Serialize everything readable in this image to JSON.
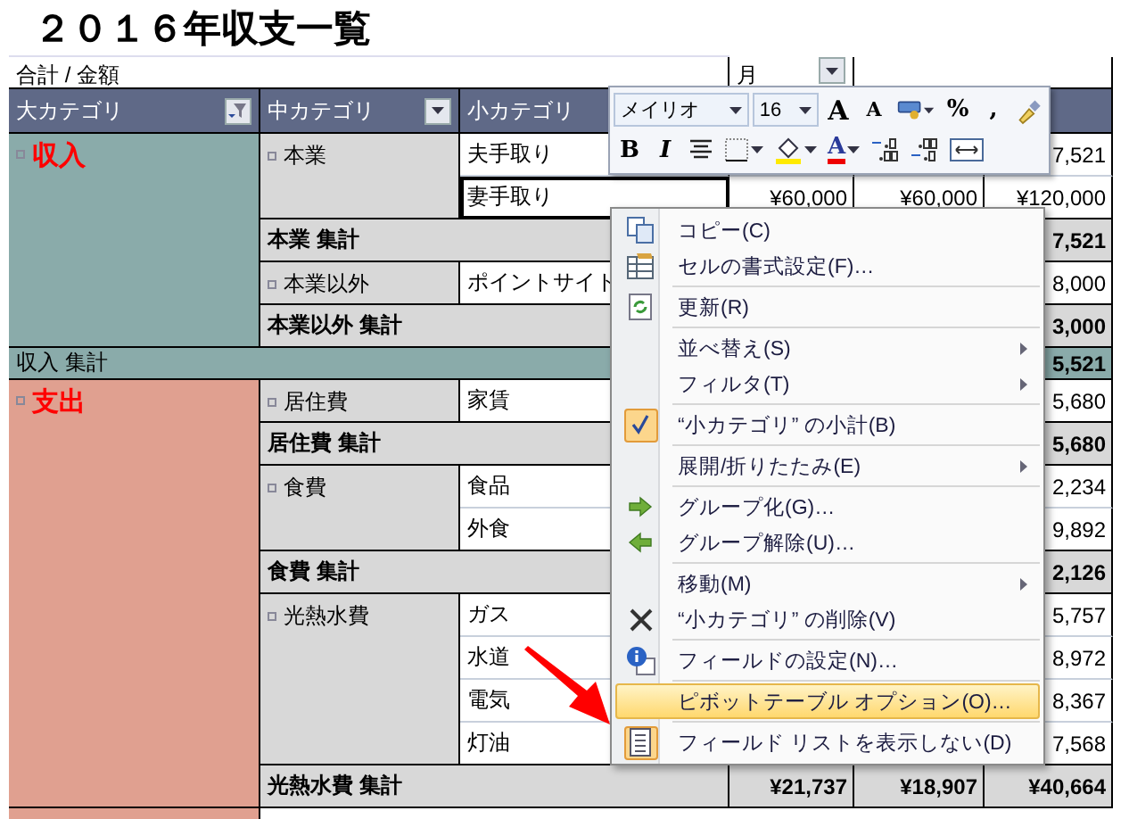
{
  "title": "２０１６年収支一覧",
  "pivot": {
    "data_label": "合計 / 金額",
    "column_field": "月",
    "headers": [
      {
        "label": "大カテゴリ",
        "filtered": true
      },
      {
        "label": "中カテゴリ",
        "filtered": false
      },
      {
        "label": "小カテゴリ"
      }
    ],
    "groups": [
      {
        "name": "収入",
        "color": "#8aabaa",
        "subgroups": [
          {
            "name": "本業",
            "items": [
              {
                "name": "夫手取り",
                "selected": false,
                "values": [
                  "7,521"
                ]
              },
              {
                "name": "妻手取り",
                "selected": true,
                "values": [
                  "¥60,000",
                  "¥60,000",
                  "¥120,000"
                ]
              }
            ],
            "total": {
              "label": "本業 集計",
              "values": [
                "7,521"
              ]
            }
          },
          {
            "name": "本業以外",
            "items": [
              {
                "name": "ポイントサイト",
                "selected": false,
                "values": [
                  "8,000"
                ]
              }
            ],
            "total": {
              "label": "本業以外 集計",
              "values": [
                "3,000"
              ]
            }
          }
        ],
        "total": {
          "label": "収入 集計",
          "values": [
            "5,521"
          ]
        }
      },
      {
        "name": "支出",
        "color": "#e0a090",
        "subgroups": [
          {
            "name": "居住費",
            "items": [
              {
                "name": "家賃",
                "selected": false,
                "values": [
                  "5,680"
                ]
              }
            ],
            "total": {
              "label": "居住費 集計",
              "values": [
                "5,680"
              ]
            }
          },
          {
            "name": "食費",
            "items": [
              {
                "name": "食品",
                "selected": false,
                "values": [
                  "2,234"
                ]
              },
              {
                "name": "外食",
                "selected": false,
                "values": [
                  "9,892"
                ]
              }
            ],
            "total": {
              "label": "食費 集計",
              "values": [
                "2,126"
              ]
            }
          },
          {
            "name": "光熱水費",
            "items": [
              {
                "name": "ガス",
                "selected": false,
                "values": [
                  "5,757"
                ]
              },
              {
                "name": "水道",
                "selected": false,
                "values": [
                  "8,972"
                ]
              },
              {
                "name": "電気",
                "selected": false,
                "values": [
                  "8,367"
                ]
              },
              {
                "name": "灯油",
                "selected": false,
                "values": [
                  "7,568"
                ]
              }
            ],
            "total": {
              "label": "光熱水費 集計",
              "values": [
                "¥21,737",
                "¥18,907",
                "¥40,664"
              ]
            }
          }
        ]
      }
    ]
  },
  "mini_toolbar": {
    "top_row": [
      {
        "kind": "font",
        "value": "メイリオ"
      },
      {
        "kind": "size",
        "value": "16"
      },
      {
        "kind": "grow",
        "label": "A"
      },
      {
        "kind": "shrink",
        "label": "A"
      },
      {
        "kind": "currency"
      },
      {
        "kind": "text",
        "label": "%"
      },
      {
        "kind": "text",
        "label": ","
      },
      {
        "kind": "painter"
      }
    ],
    "bottom_row": [
      {
        "kind": "bold",
        "label": "B"
      },
      {
        "kind": "italic",
        "label": "I"
      },
      {
        "kind": "center"
      },
      {
        "kind": "borders"
      },
      {
        "kind": "fill"
      },
      {
        "kind": "fontcolor",
        "label": "A"
      },
      {
        "kind": "incdec"
      },
      {
        "kind": "decdec"
      },
      {
        "kind": "merge"
      }
    ]
  },
  "context_menu": {
    "groups": [
      [
        {
          "label": "コピー(C)",
          "kind": "copy",
          "submenu": false,
          "checked": false,
          "selected": false
        },
        {
          "label": "セルの書式設定(F)…",
          "kind": "format",
          "submenu": false,
          "checked": false,
          "selected": false
        }
      ],
      [
        {
          "label": "更新(R)",
          "kind": "refresh",
          "submenu": false,
          "checked": false,
          "selected": false
        }
      ],
      [
        {
          "label": "並べ替え(S)",
          "kind": "plain",
          "submenu": true,
          "checked": false,
          "selected": false
        },
        {
          "label": "フィルタ(T)",
          "kind": "plain",
          "submenu": true,
          "checked": false,
          "selected": false
        }
      ],
      [
        {
          "label": "“小カテゴリ” の小計(B)",
          "kind": "check",
          "submenu": false,
          "checked": true,
          "selected": false
        }
      ],
      [
        {
          "label": "展開/折りたたみ(E)",
          "kind": "plain",
          "submenu": true,
          "checked": false,
          "selected": false
        }
      ],
      [
        {
          "label": "グループ化(G)…",
          "kind": "group",
          "submenu": false,
          "checked": false,
          "selected": false
        },
        {
          "label": "グループ解除(U)…",
          "kind": "ungroup",
          "submenu": false,
          "checked": false,
          "selected": false
        }
      ],
      [
        {
          "label": "移動(M)",
          "kind": "plain",
          "submenu": true,
          "checked": false,
          "selected": false
        },
        {
          "label": "“小カテゴリ” の削除(V)",
          "kind": "delete",
          "submenu": false,
          "checked": false,
          "selected": false
        }
      ],
      [
        {
          "label": "フィールドの設定(N)…",
          "kind": "info",
          "submenu": false,
          "checked": false,
          "selected": false
        }
      ],
      [
        {
          "label": "ピボットテーブル オプション(O)…",
          "kind": "plain",
          "submenu": false,
          "checked": false,
          "selected": true
        }
      ],
      [
        {
          "label": "フィールド リストを表示しない(D)",
          "kind": "list",
          "submenu": false,
          "checked": true,
          "selected": false
        }
      ]
    ]
  }
}
